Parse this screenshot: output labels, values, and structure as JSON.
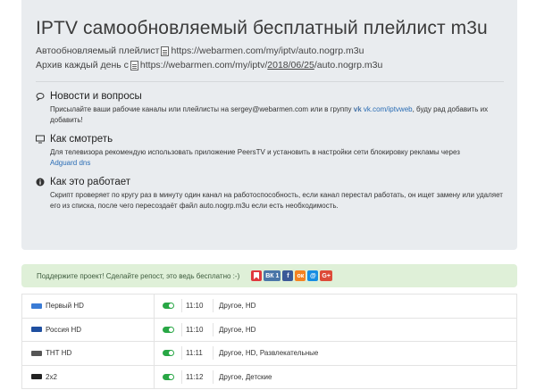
{
  "header": {
    "title": "IPTV самообновляемый бесплатный плейлист m3u",
    "auto_label": "Автообновляемый плейлист",
    "auto_url": "https://webarmen.com/my/iptv/auto.nogrp.m3u",
    "archive_label": "Архив каждый день с",
    "archive_url_pre": "https://webarmen.com/my/iptv/",
    "archive_url_date": "2018/06/25",
    "archive_url_post": "/auto.nogrp.m3u"
  },
  "sections": {
    "news": {
      "title": "Новости и вопросы",
      "text_pre": "Присылайте ваши рабочие каналы или плейлисты на sergey@webarmen.com или в группу ",
      "vk_mark": "vk",
      "link": "vk.com/iptvweb",
      "text_post": ", буду рад добавить их добавить!"
    },
    "watch": {
      "title": "Как смотреть",
      "text": "Для телевизора рекомендую использовать приложение PeersTV и установить в настройки сети блокировку рекламы через",
      "link": "Adguard dns"
    },
    "how": {
      "title": "Как это работает",
      "text": "Скрипт проверяет по кругу раз в минуту один канал на работоспособность, если канал перестал работать, он ищет замену или удаляет его из списка, после чего пересоздаёт файл auto.nogrp.m3u если есть необходимость."
    }
  },
  "share": {
    "text": "Поддержите проект! Сделайте репост, это ведь бесплатно :-)",
    "buttons": [
      {
        "name": "bookmark",
        "label": "",
        "color": "#e0383e"
      },
      {
        "name": "vk",
        "label": "ВК 1",
        "color": "#4a76a8"
      },
      {
        "name": "facebook",
        "label": "f",
        "color": "#3b5998"
      },
      {
        "name": "odnoklassniki",
        "label": "ок",
        "color": "#f58220"
      },
      {
        "name": "mailru",
        "label": "@",
        "color": "#168de2"
      },
      {
        "name": "googleplus",
        "label": "G+",
        "color": "#dd4b39"
      }
    ]
  },
  "channels": [
    {
      "name": "Первый HD",
      "time": "11:10",
      "categories": "Другое, HD",
      "logo_color": "#3a7bd5"
    },
    {
      "name": "Россия HD",
      "time": "11:10",
      "categories": "Другое, HD",
      "logo_color": "#1f4fa0"
    },
    {
      "name": "ТНТ HD",
      "time": "11:11",
      "categories": "Другое, HD, Развлекательные",
      "logo_color": "#555555"
    },
    {
      "name": "2x2",
      "time": "11:12",
      "categories": "Другое, Детские",
      "logo_color": "#222222"
    }
  ]
}
